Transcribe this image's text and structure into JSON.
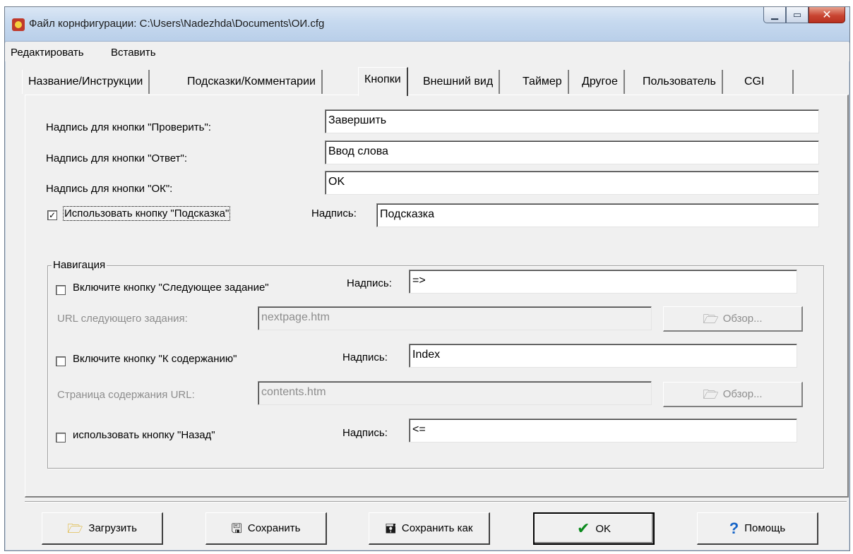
{
  "window": {
    "title": "Файл корнфигурации: C:\\Users\\Nadezhda\\Documents\\ОИ.cfg",
    "controls": [
      "minimize-icon",
      "maximize-icon",
      "close-icon"
    ]
  },
  "menu": {
    "items": [
      {
        "label": "Редактировать"
      },
      {
        "label": "Вставить"
      }
    ]
  },
  "tabs": [
    {
      "label": "Название/Инструкции"
    },
    {
      "label": "Подсказки/Комментарии"
    },
    {
      "label": "Кнопки",
      "active": true
    },
    {
      "label": "Внешний вид"
    },
    {
      "label": "Таймер"
    },
    {
      "label": "Другое"
    },
    {
      "label": "Пользователь"
    },
    {
      "label": "CGI"
    }
  ],
  "buttons_tab": {
    "check_label": "Надпись для кнопки \"Проверить\":",
    "check_value": "Завершить",
    "answer_label": "Надпись для кнопки \"Ответ\":",
    "answer_value": "Ввод слова",
    "ok_label": "Надпись для кнопки \"ОК\":",
    "ok_value": "OK",
    "hint_checkbox_label": "Использовать кнопку \"Подсказка\"",
    "hint_checked": true,
    "hint_caption_label": "Надпись:",
    "hint_caption_value": "Подсказка"
  },
  "navigation": {
    "legend": "Навигация",
    "next_checkbox_label": "Включите кнопку \"Следующее задание\"",
    "next_caption_label": "Надпись:",
    "next_caption_value": "=>",
    "next_url_label": "URL следующего задания:",
    "next_url_value": "nextpage.htm",
    "browse_label": "Обзор...",
    "contents_checkbox_label": "Включите кнопку \"К содержанию\"",
    "contents_caption_label": "Надпись:",
    "contents_caption_value": "Index",
    "contents_url_label": "Страница содержания URL:",
    "contents_url_value": "contents.htm",
    "back_checkbox_label": "использовать кнопку \"Назад\"",
    "back_caption_label": "Надпись:",
    "back_caption_value": "<="
  },
  "footer": {
    "load_label": "Загрузить",
    "save_label": "Сохранить",
    "save_as_label": "Сохранить как",
    "ok_label": "OK",
    "help_label": "Помощь"
  },
  "colors": {
    "window_bg": "#f0f0f0",
    "check_icon": "#0b8a1d",
    "help_icon": "#1463c7",
    "folder_icon": "#d9a400"
  }
}
